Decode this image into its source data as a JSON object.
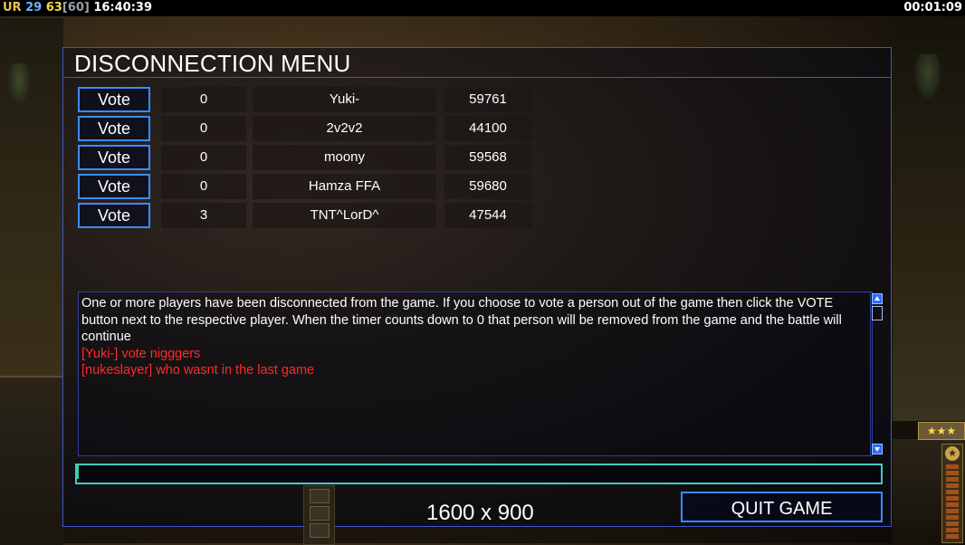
{
  "top_bar": {
    "left": {
      "label": "UR",
      "val_a": "29",
      "val_b": "63",
      "val_c": "[60]",
      "clock": "16:40:39"
    },
    "right_timer": "00:01:09"
  },
  "dialog": {
    "title": "DISCONNECTION MENU",
    "vote_label": "Vote",
    "players": [
      {
        "votes": "0",
        "name": "Yuki-",
        "score": "59761"
      },
      {
        "votes": "0",
        "name": "2v2v2",
        "score": "44100"
      },
      {
        "votes": "0",
        "name": "moony",
        "score": "59568"
      },
      {
        "votes": "0",
        "name": "Hamza FFA",
        "score": "59680"
      },
      {
        "votes": "3",
        "name": "TNT^LorD^",
        "score": "47544"
      }
    ],
    "messages": {
      "system": "One or more players have been disconnected from the game. If you choose to vote a person out of the game then click the VOTE button next to the respective player. When the timer counts down to 0 that person will be removed from the game and the battle will continue",
      "chat_1": "[Yuki-] vote nigggers",
      "chat_2": "[nukeslayer] who wasnt in the last game"
    },
    "chat_input_value": "",
    "resolution": "1600 x 900",
    "quit_label": "QUIT GAME"
  },
  "hud": {
    "stars": "★★★"
  },
  "colors": {
    "accent_border": "#3a8cff",
    "chat_red": "#ff2a2a",
    "input_border": "#49c9c2"
  }
}
